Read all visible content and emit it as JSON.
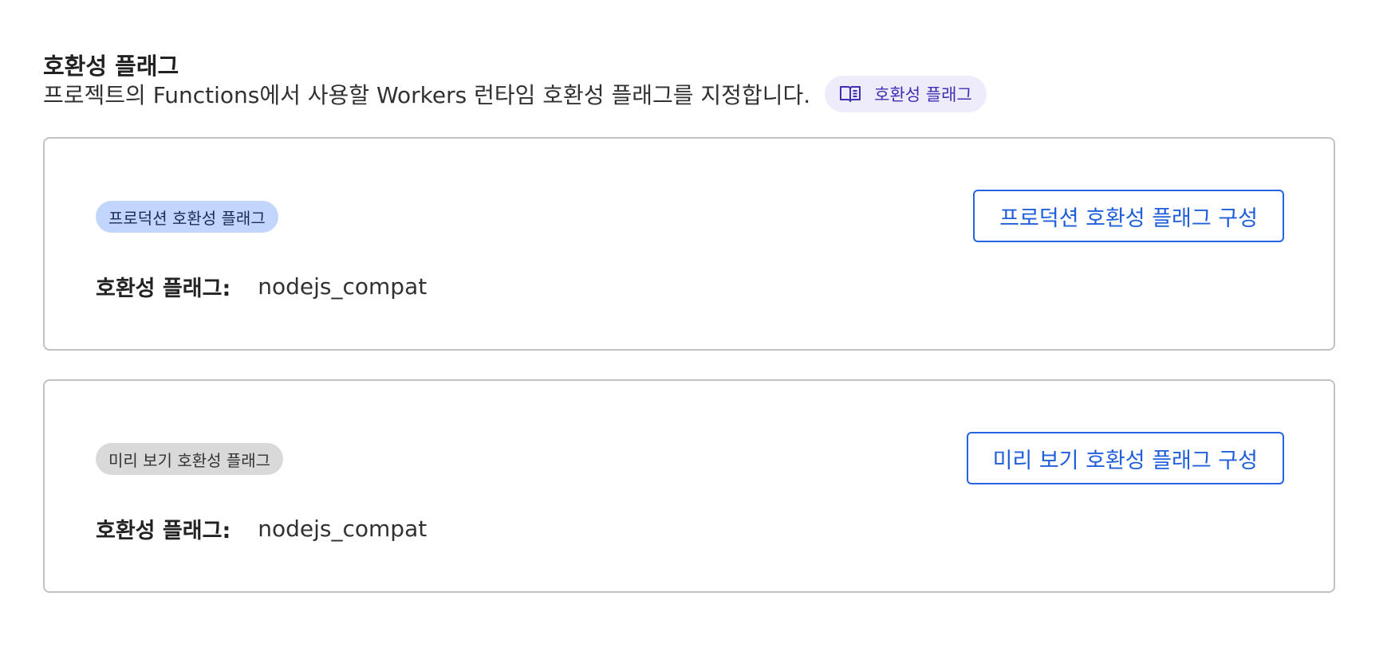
{
  "section": {
    "title": "호환성 플래그",
    "description": "프로젝트의 Functions에서 사용할 Workers 런타임 호환성 플래그를 지정합니다.",
    "doc_link_label": "호환성 플래그",
    "doc_link_icon": "book-open-icon"
  },
  "production": {
    "badge": "프로덕션 호환성 플래그",
    "flags_label": "호환성 플래그:",
    "flags_value": "nodejs_compat",
    "configure_button": "프로덕션 호환성 플래그 구성"
  },
  "preview": {
    "badge": "미리 보기 호환성 플래그",
    "flags_label": "호환성 플래그:",
    "flags_value": "nodejs_compat",
    "configure_button": "미리 보기 호환성 플래그 구성"
  },
  "colors": {
    "accent": "#2564e0",
    "production_badge_bg": "#c2d6fb",
    "preview_badge_bg": "#d9d9d9",
    "doc_pill_bg": "#eeecfb",
    "doc_pill_text": "#3d2fb3",
    "card_border": "#c2c2c2"
  }
}
